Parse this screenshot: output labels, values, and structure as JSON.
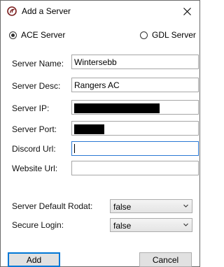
{
  "window": {
    "title": "Add a Server"
  },
  "server_type": {
    "options": [
      {
        "label": "ACE Server",
        "selected": true
      },
      {
        "label": "GDL Server",
        "selected": false
      }
    ]
  },
  "fields": {
    "server_name": {
      "label": "Server Name:",
      "value": "Wintersebb"
    },
    "server_desc": {
      "label": "Server Desc:",
      "value": "Rangers AC"
    },
    "server_ip": {
      "label": "Server IP:",
      "value": ""
    },
    "server_port": {
      "label": "Server Port:",
      "value": ""
    },
    "discord_url": {
      "label": "Discord Url:",
      "value": ""
    },
    "website_url": {
      "label": "Website Url:",
      "value": ""
    }
  },
  "dropdowns": {
    "default_rodat": {
      "label": "Server Default Rodat:",
      "value": "false"
    },
    "secure_login": {
      "label": "Secure Login:",
      "value": "false"
    }
  },
  "buttons": {
    "add": "Add",
    "cancel": "Cancel"
  },
  "colors": {
    "focus_border": "#2b79d4",
    "default_button_border": "#0078d7",
    "button_face": "#e1e1e1"
  }
}
